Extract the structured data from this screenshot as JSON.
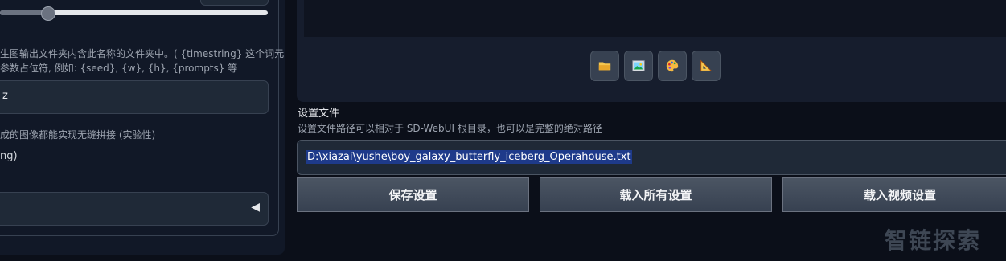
{
  "left": {
    "filename_desc_line1": "生图输出文件夹内含此名称的文件夹中。( {timestring} 这个词元",
    "filename_desc_line2": "参数占位符, 例如: {seed}, {w}, {h}, {prompts} 等",
    "subfolder_input_value": "z",
    "seamless_desc": "成的图像都能实现无缝拼接 (实验性)",
    "option_label": "ng)",
    "dropdown_arrow": "◀"
  },
  "gallery": {
    "tools": [
      "open-folder-icon",
      "image-icon",
      "palette-icon",
      "ruler-icon"
    ]
  },
  "settings": {
    "title": "设置文件",
    "desc": "设置文件路径可以相对于 SD-WebUI 根目录，也可以是完整的绝对路径",
    "path_value": "D:\\xiazai\\yushe\\boy_galaxy_butterfly_iceberg_Operahouse.txt"
  },
  "actions": {
    "save_label": "保存设置",
    "load_all_label": "载入所有设置",
    "load_video_label": "载入视频设置"
  },
  "watermark": "智链探索"
}
